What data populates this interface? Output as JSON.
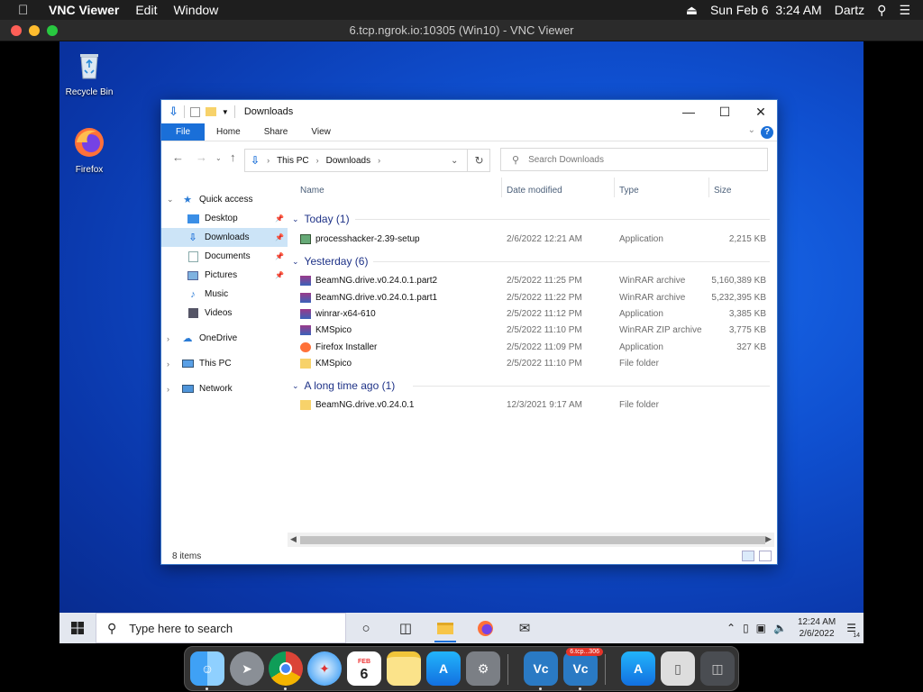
{
  "mac_menubar": {
    "app_name": "VNC Viewer",
    "menus": [
      "Edit",
      "Window"
    ],
    "datetime": "Sun Feb 6  3:24 AM",
    "user": "Dartz"
  },
  "vnc_window": {
    "title": "6.tcp.ngrok.io:10305 (Win10) - VNC Viewer"
  },
  "desktop": {
    "icons": [
      {
        "label": "Recycle Bin"
      },
      {
        "label": "Firefox"
      }
    ]
  },
  "explorer": {
    "title": "Downloads",
    "ribbon_tabs": [
      "File",
      "Home",
      "Share",
      "View"
    ],
    "address": {
      "root": "This PC",
      "current": "Downloads"
    },
    "search_placeholder": "Search Downloads",
    "nav": {
      "quick_access": "Quick access",
      "items": [
        "Desktop",
        "Downloads",
        "Documents",
        "Pictures",
        "Music",
        "Videos"
      ],
      "onedrive": "OneDrive",
      "this_pc": "This PC",
      "network": "Network"
    },
    "columns": {
      "name": "Name",
      "date": "Date modified",
      "type": "Type",
      "size": "Size"
    },
    "groups": {
      "today": {
        "label": "Today (1)",
        "files": [
          {
            "name": "processhacker-2.39-setup",
            "date": "2/6/2022 12:21 AM",
            "type": "Application",
            "size": "2,215 KB"
          }
        ]
      },
      "yesterday": {
        "label": "Yesterday (6)",
        "files": [
          {
            "name": "BeamNG.drive.v0.24.0.1.part2",
            "date": "2/5/2022 11:25 PM",
            "type": "WinRAR archive",
            "size": "5,160,389 KB"
          },
          {
            "name": "BeamNG.drive.v0.24.0.1.part1",
            "date": "2/5/2022 11:22 PM",
            "type": "WinRAR archive",
            "size": "5,232,395 KB"
          },
          {
            "name": "winrar-x64-610",
            "date": "2/5/2022 11:12 PM",
            "type": "Application",
            "size": "3,385 KB"
          },
          {
            "name": "KMSpico",
            "date": "2/5/2022 11:10 PM",
            "type": "WinRAR ZIP archive",
            "size": "3,775 KB"
          },
          {
            "name": "Firefox Installer",
            "date": "2/5/2022 11:09 PM",
            "type": "Application",
            "size": "327 KB"
          },
          {
            "name": "KMSpico",
            "date": "2/5/2022 11:10 PM",
            "type": "File folder",
            "size": ""
          }
        ]
      },
      "older": {
        "label": "A long time ago (1)",
        "files": [
          {
            "name": "BeamNG.drive.v0.24.0.1",
            "date": "12/3/2021 9:17 AM",
            "type": "File folder",
            "size": ""
          }
        ]
      }
    },
    "status": "8 items"
  },
  "taskbar": {
    "search_placeholder": "Type here to search",
    "time": "12:24 AM",
    "date": "2/6/2022",
    "notifications": "14"
  },
  "dock": {
    "calendar_month": "FEB",
    "calendar_day": "6",
    "vnc_badge": "6.tcp...306"
  },
  "colors": {
    "accent": "#1a6fd8",
    "group_header": "#1e3287",
    "selection": "#cce4f7"
  }
}
